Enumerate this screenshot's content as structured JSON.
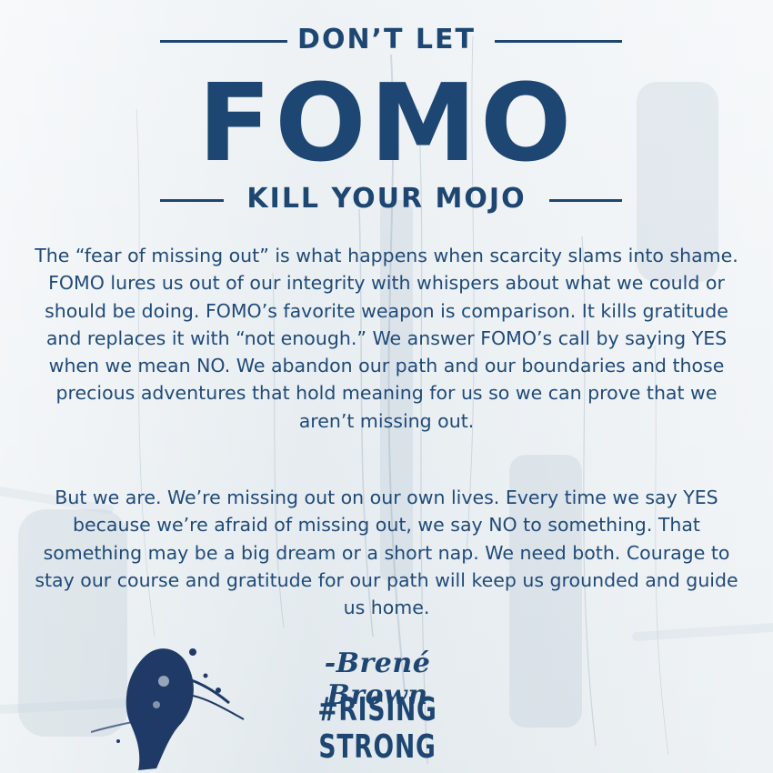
{
  "header": {
    "kicker_top": "DON’T LET",
    "headline": "FOMO",
    "kicker_bottom": "KILL YOUR MOJO"
  },
  "body": {
    "paragraph_1": "The “fear of missing out” is what happens when scarcity slams into shame. FOMO lures us out of our integrity with whispers about what we could or should be doing. FOMO’s favorite weapon is comparison. It kills gratitude and replaces it with “not enough.” We answer FOMO’s call by saying YES when we mean NO. We abandon our path and our boundaries and those precious adventures that hold meaning for us so we can prove that we aren’t missing out.",
    "paragraph_2": "But we are. We’re missing out on our own lives. Every time we say YES because we’re afraid of missing out, we say NO to something. That something may be a big dream or a short nap. We need both. Courage to stay our course and gratitude for our path will keep us grounded and guide us home."
  },
  "footer": {
    "attribution": "-Brené Brown",
    "hashtag": "#RISING STRONG"
  },
  "colors": {
    "ink": "#1d4672",
    "background": "#e8edf1"
  }
}
